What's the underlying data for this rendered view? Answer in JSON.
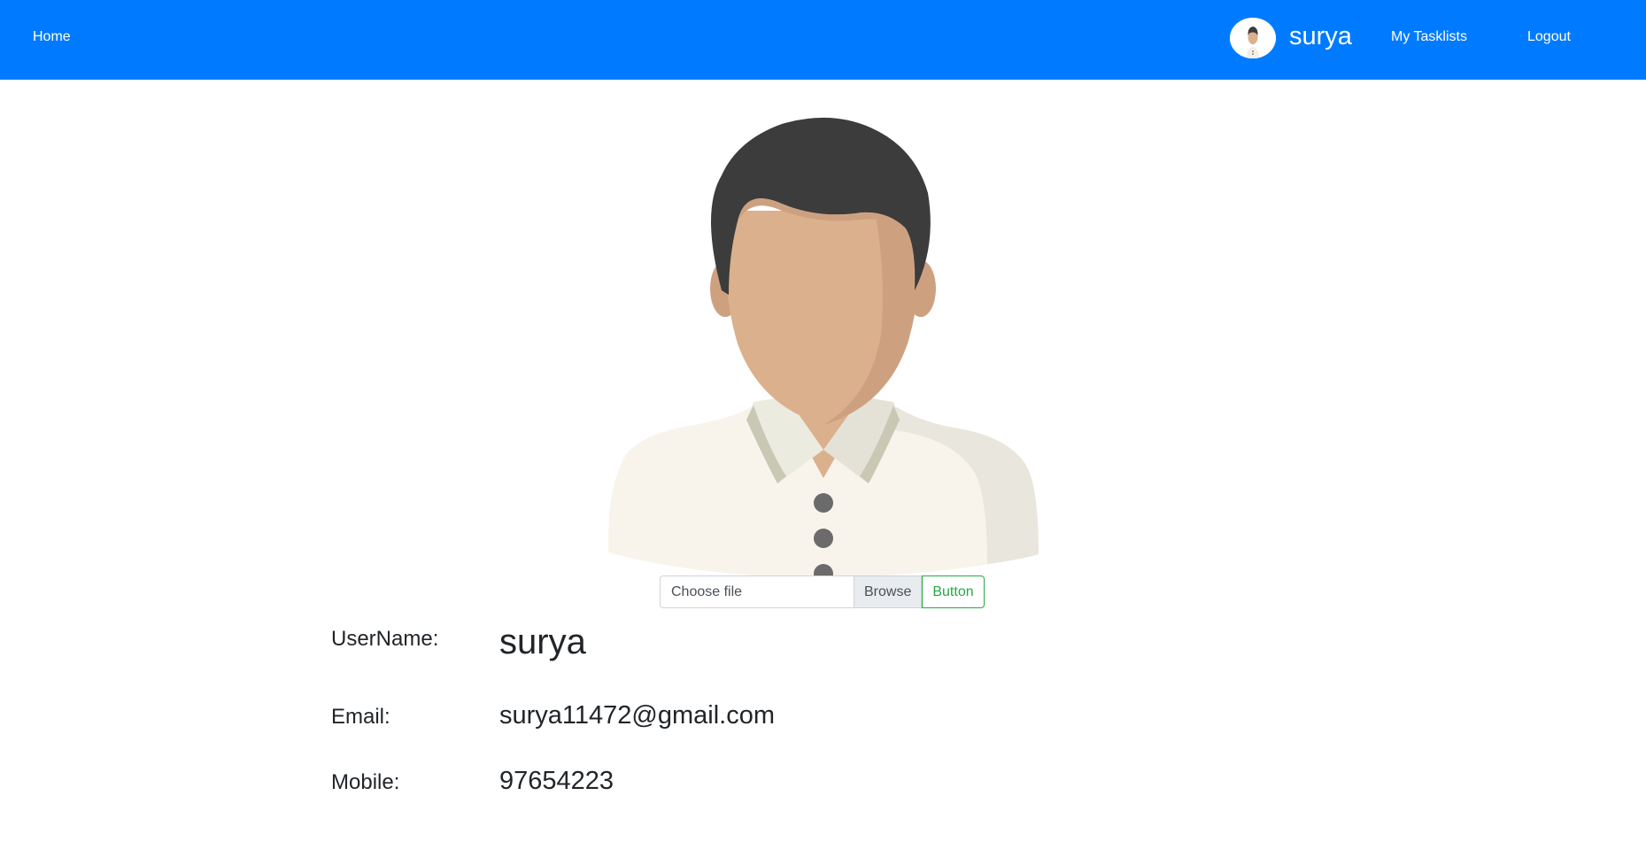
{
  "navbar": {
    "home_label": "Home",
    "username": "surya",
    "tasklists_label": "My Tasklists",
    "logout_label": "Logout",
    "background": "#007bff"
  },
  "upload": {
    "file_placeholder": "Choose file",
    "browse_label": "Browse",
    "button_label": "Button"
  },
  "profile": {
    "username_label": "UserName:",
    "username_value": "surya",
    "email_label": "Email:",
    "email_value": "surya11472@gmail.com",
    "mobile_label": "Mobile:",
    "mobile_value": "97654223"
  },
  "colors": {
    "primary": "#007bff",
    "success": "#28a745",
    "hair": "#3c3c3c",
    "skin": "#dbb08c",
    "skin_shadow": "#cda180",
    "shirt": "#f8f4ec",
    "shirt_shadow": "#e8e6dd",
    "button_dot": "#6b6b6b"
  }
}
